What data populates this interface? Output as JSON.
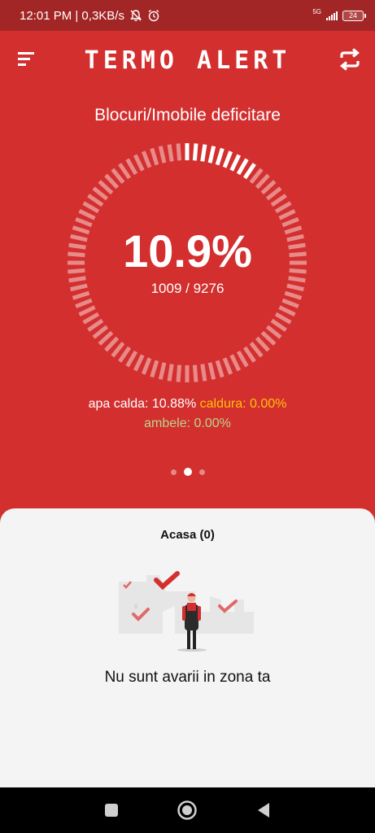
{
  "status_bar": {
    "time_speed": "12:01 PM | 0,3KB/s",
    "network": "5G",
    "battery": "24"
  },
  "header": {
    "title": "TERMO ALERT",
    "menu_icon": "menu-icon",
    "refresh_icon": "refresh-icon"
  },
  "summary": {
    "title": "Blocuri/Imobile deficitare",
    "percentage": "10.9%",
    "percentage_value": 10.9,
    "count": "1009 / 9276"
  },
  "breakdown": {
    "apa_calda": "apa calda: 10.88%",
    "caldura": "caldura: 0.00%",
    "ambele": "ambele: 0.00%",
    "colors": {
      "apa_calda": "#ffffff",
      "caldura": "#ffc107",
      "ambele": "#b9d48c"
    }
  },
  "pager": {
    "pages": 3,
    "active": 1
  },
  "sheet": {
    "title": "Acasa (0)",
    "empty_message": "Nu sunt avarii in zona ta"
  },
  "nav": {
    "icons": [
      "recent-apps-icon",
      "home-icon",
      "back-icon"
    ]
  },
  "colors": {
    "primary": "#d32f2f",
    "status_bar": "#a32626",
    "sheet": "#f4f4f4"
  }
}
